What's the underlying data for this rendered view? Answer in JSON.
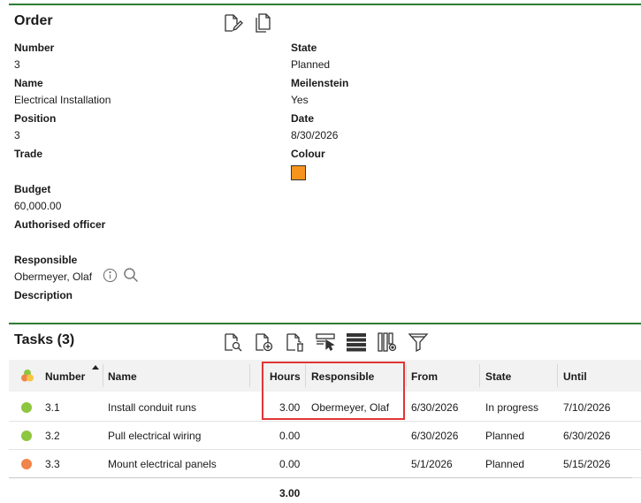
{
  "order": {
    "title": "Order",
    "fields": {
      "number_label": "Number",
      "number_value": "3",
      "name_label": "Name",
      "name_value": "Electrical Installation",
      "position_label": "Position",
      "position_value": "3",
      "trade_label": "Trade",
      "budget_label": "Budget",
      "budget_value": "60,000.00",
      "authorised_label": "Authorised officer",
      "responsible_label": "Responsible",
      "responsible_value": "Obermeyer, Olaf",
      "description_label": "Description",
      "state_label": "State",
      "state_value": "Planned",
      "meilenstein_label": "Meilenstein",
      "meilenstein_value": "Yes",
      "date_label": "Date",
      "date_value": "8/30/2026",
      "colour_label": "Colour",
      "colour_value": "#f7941d"
    },
    "toolbar": [
      "edit-document-icon",
      "copy-document-icon"
    ]
  },
  "tasks": {
    "title": "Tasks (3)",
    "toolbar": [
      "view-document-icon",
      "add-document-icon",
      "delete-document-icon",
      "select-cursor-icon",
      "rows-icon",
      "columns-settings-icon",
      "filter-icon"
    ],
    "headers": {
      "number": "Number",
      "name": "Name",
      "hours": "Hours",
      "responsible": "Responsible",
      "from": "From",
      "state": "State",
      "until": "Until"
    },
    "rows": [
      {
        "status_color": "#8dc63f",
        "number": "3.1",
        "name": "Install conduit runs",
        "hours": "3.00",
        "responsible": "Obermeyer, Olaf",
        "from": "6/30/2026",
        "state": "In progress",
        "until": "7/10/2026"
      },
      {
        "status_color": "#8dc63f",
        "number": "3.2",
        "name": "Pull electrical wiring",
        "hours": "0.00",
        "responsible": "",
        "from": "6/30/2026",
        "state": "Planned",
        "until": "6/30/2026"
      },
      {
        "status_color": "#f0844a",
        "number": "3.3",
        "name": "Mount electrical panels",
        "hours": "0.00",
        "responsible": "",
        "from": "5/1/2026",
        "state": "Planned",
        "until": "5/15/2026"
      }
    ],
    "total_hours": "3.00"
  },
  "colors": {
    "accent_rule": "#2e7d32",
    "highlight": "#e03535"
  }
}
